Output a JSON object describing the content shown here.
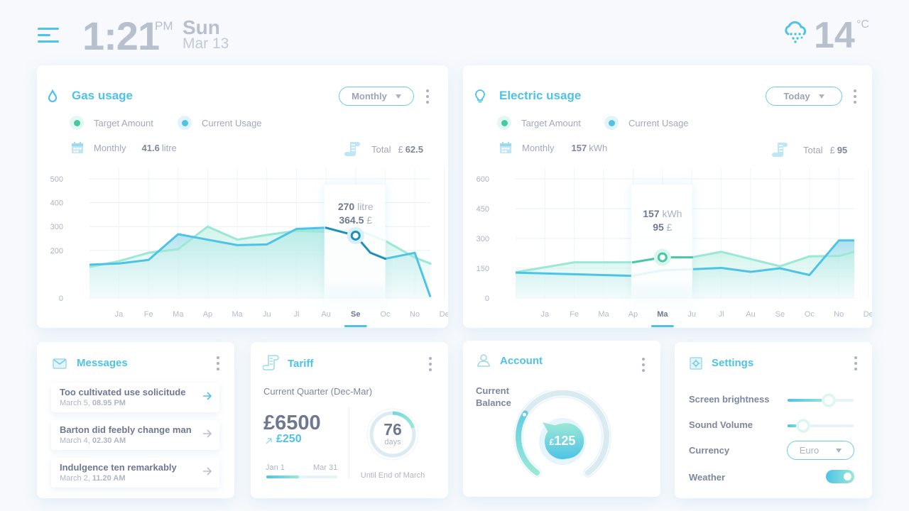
{
  "header": {
    "time": "1:21",
    "ampm": "PM",
    "day": "Sun",
    "date": "Mar 13",
    "temperature": "14",
    "temp_unit": "°C",
    "weather_icon": "rain-cloud-icon",
    "menu_icon": "hamburger-menu-icon"
  },
  "colors": {
    "accent": "#4ec3e6",
    "target": "#9be8d6",
    "target_dark": "#45c8a4",
    "current": "#4ec3e6",
    "current_dark": "#1f8fba",
    "text": "#7d879c",
    "muted": "#a1a9ba"
  },
  "gas": {
    "title": "Gas usage",
    "icon": "flame-drop-icon",
    "period": "Monthly",
    "legend": [
      "Target Amount",
      "Current Usage"
    ],
    "monthly_label": "Monthly",
    "monthly_value": "41.6",
    "monthly_unit": "litre",
    "total_label": "Total",
    "total_currency": "£",
    "total_value": "62.5",
    "tooltip": {
      "value1": "270",
      "unit1": "litre",
      "value2": "364.5",
      "unit2": "£"
    },
    "selected_month": "Se"
  },
  "electric": {
    "title": "Electric usage",
    "icon": "light-bulb-icon",
    "period": "Today",
    "legend": [
      "Target Amount",
      "Current Usage"
    ],
    "monthly_label": "Monthly",
    "monthly_value": "157",
    "monthly_unit": "kWh",
    "total_label": "Total",
    "total_currency": "£",
    "total_value": "95",
    "tooltip": {
      "value1": "157",
      "unit1": "kWh",
      "value2": "95",
      "unit2": "£"
    },
    "selected_month": "Ma"
  },
  "chart_data": [
    {
      "type": "line",
      "title": "Gas usage",
      "categories": [
        "Ja",
        "Fe",
        "Ma",
        "Ap",
        "Ma",
        "Ju",
        "Jl",
        "Au",
        "Se",
        "Oc",
        "No",
        "De"
      ],
      "ylim": [
        0,
        500
      ],
      "yticks": [
        0,
        200,
        300,
        400,
        500
      ],
      "grid": true,
      "selected_index": 8,
      "series": [
        {
          "name": "Target Amount",
          "points": [
            [
              -1,
              130
            ],
            [
              0,
              155
            ],
            [
              1,
              190
            ],
            [
              2,
              205
            ],
            [
              3,
              300
            ],
            [
              4,
              245
            ],
            [
              5,
              265
            ],
            [
              6,
              282
            ],
            [
              7,
              278
            ],
            [
              8,
              290
            ],
            [
              9,
              240
            ],
            [
              10,
              170
            ],
            [
              11,
              145
            ],
            [
              11.5,
              140
            ]
          ]
        },
        {
          "name": "Current Usage",
          "points": [
            [
              -1,
              140
            ],
            [
              0,
              145
            ],
            [
              1,
              160
            ],
            [
              2,
              268
            ],
            [
              3,
              245
            ],
            [
              4,
              222
            ],
            [
              5,
              225
            ],
            [
              6,
              290
            ],
            [
              7,
              295
            ],
            [
              8,
              262
            ],
            [
              8.5,
              190
            ],
            [
              9,
              165
            ],
            [
              10,
              190
            ],
            [
              11.5,
              5
            ]
          ]
        }
      ],
      "highlight_point": {
        "x": 8,
        "y": 262,
        "series": "Current Usage"
      }
    },
    {
      "type": "line",
      "title": "Electric usage",
      "categories": [
        "Ja",
        "Fe",
        "Ma",
        "Ap",
        "Ma",
        "Ju",
        "Jl",
        "Au",
        "Se",
        "Oc",
        "No",
        "De"
      ],
      "ylim": [
        0,
        600
      ],
      "yticks": [
        0,
        150,
        300,
        450,
        600
      ],
      "grid": true,
      "selected_index": 4,
      "series": [
        {
          "name": "Target Amount",
          "points": [
            [
              -1,
              130
            ],
            [
              1,
              180
            ],
            [
              3,
              180
            ],
            [
              4,
              205
            ],
            [
              5,
              205
            ],
            [
              6,
              233
            ],
            [
              8,
              160
            ],
            [
              9,
              210
            ],
            [
              10,
              212
            ],
            [
              10.5,
              232
            ],
            [
              11.5,
              232
            ]
          ]
        },
        {
          "name": "Current Usage",
          "points": [
            [
              -1,
              128
            ],
            [
              3,
              112
            ],
            [
              4,
              140
            ],
            [
              5,
              145
            ],
            [
              6,
              152
            ],
            [
              7,
              132
            ],
            [
              8,
              150
            ],
            [
              9,
              116
            ],
            [
              10,
              290
            ],
            [
              11.5,
              290
            ]
          ]
        }
      ],
      "highlight_point": {
        "x": 4,
        "y": 205,
        "series": "Target Amount"
      }
    }
  ],
  "messages": {
    "title": "Messages",
    "icon": "envelope-icon",
    "items": [
      {
        "subject": "Too cultivated use solicitude",
        "date": "March 5,",
        "time": "08.95 PM"
      },
      {
        "subject": "Barton did feebly change man",
        "date": "March 4,",
        "time": "02.30 AM"
      },
      {
        "subject": "Indulgence ten remarkably",
        "date": "March 2,",
        "time": "11.20 AM"
      }
    ]
  },
  "tariff": {
    "title": "Tariff",
    "icon": "receipt-scroll-icon",
    "subtitle": "Current Quarter (Dec-Mar)",
    "amount": "£6500",
    "change": "£250",
    "range_start": "Jan 1",
    "range_end": "Mar 31",
    "range_progress": 0.46,
    "days_value": "76",
    "days_label": "days",
    "days_progress": 0.2,
    "caption": "Until End of March"
  },
  "account": {
    "title": "Account",
    "icon": "user-icon",
    "label_line1": "Current",
    "label_line2": "Balance",
    "currency": "£",
    "balance": "125",
    "gauge_fraction": 0.3
  },
  "settings": {
    "title": "Settings",
    "icon": "gear-square-icon",
    "brightness_label": "Screen brightness",
    "brightness_value": 0.62,
    "volume_label": "Sound Volume",
    "volume_value": 0.24,
    "currency_label": "Currency",
    "currency_value": "Euro",
    "weather_label": "Weather",
    "weather_on": true
  }
}
